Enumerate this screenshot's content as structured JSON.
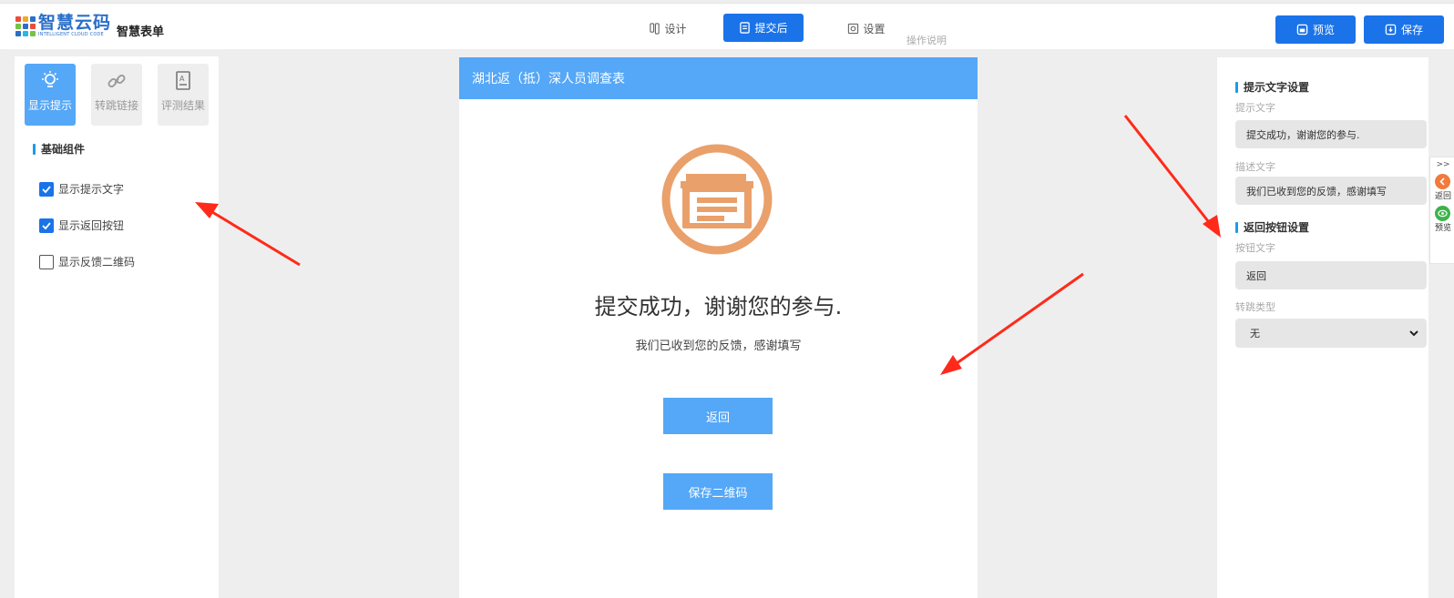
{
  "header": {
    "logo_title": "智慧云码",
    "logo_subtitle": "INTELLIGENT CLOUD CODE",
    "app_name": "智慧表单",
    "tabs": [
      {
        "label": "设计",
        "icon": "design-icon"
      },
      {
        "label": "提交后",
        "icon": "submit-icon"
      },
      {
        "label": "设置",
        "icon": "settings-icon"
      }
    ],
    "help_link": "操作说明",
    "preview_label": "预览",
    "save_label": "保存"
  },
  "left_panel": {
    "tabs": [
      {
        "label": "显示提示",
        "icon": "bulb-icon"
      },
      {
        "label": "转跳链接",
        "icon": "link-icon"
      },
      {
        "label": "评测结果",
        "icon": "report-icon"
      }
    ],
    "section_title": "基础组件",
    "options": [
      {
        "label": "显示提示文字",
        "checked": true
      },
      {
        "label": "显示返回按钮",
        "checked": true
      },
      {
        "label": "显示反馈二维码",
        "checked": false
      }
    ]
  },
  "form": {
    "title": "湖北返（抵）深人员调查表",
    "success_title": "提交成功，谢谢您的参与.",
    "success_desc": "我们已收到您的反馈，感谢填写",
    "back_button": "返回",
    "qr_button": "保存二维码",
    "icon": "document-icon",
    "icon_color": "#eaa06a"
  },
  "right_panel": {
    "tip_section_title": "提示文字设置",
    "tip_label": "提示文字",
    "tip_value": "提交成功，谢谢您的参与.",
    "desc_label": "描述文字",
    "desc_value": "我们已收到您的反馈，感谢填写",
    "back_section_title": "返回按钮设置",
    "button_text_label": "按钮文字",
    "button_text_value": "返回",
    "jump_type_label": "转跳类型",
    "jump_type_value": "无"
  },
  "side_tools": {
    "collapse": ">>",
    "back_label": "返回",
    "preview_label": "预览"
  },
  "colors": {
    "primary": "#1a73e8",
    "light_blue": "#55a7f7",
    "annotation_red": "#ff2a1a"
  }
}
